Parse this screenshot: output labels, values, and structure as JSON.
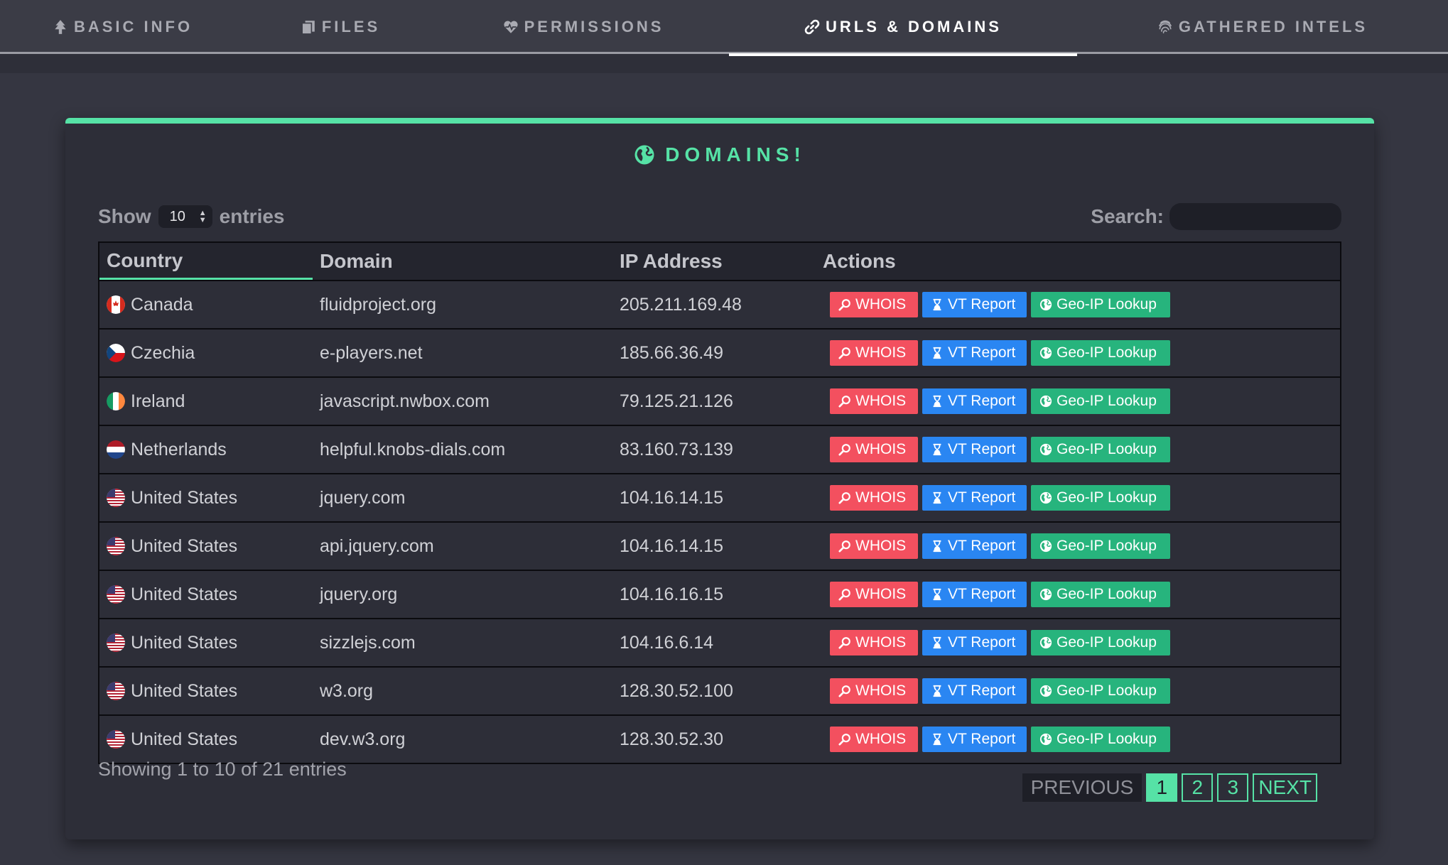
{
  "tabs": [
    {
      "label": "BASIC INFO",
      "icon": "tree-icon",
      "active": false
    },
    {
      "label": "FILES",
      "icon": "files-icon",
      "active": false
    },
    {
      "label": "PERMISSIONS",
      "icon": "heart-pulse-icon",
      "active": false
    },
    {
      "label": "URLS & DOMAINS",
      "icon": "link-icon",
      "active": true
    },
    {
      "label": "GATHERED INTELS",
      "icon": "fingerprint-icon",
      "active": false
    }
  ],
  "card": {
    "title": "DOMAINS!",
    "icon": "globe-icon",
    "accent": "#56e2a6"
  },
  "length": {
    "show_label": "Show",
    "value": "10",
    "entries_label": "entries"
  },
  "search": {
    "label": "Search:",
    "value": ""
  },
  "table": {
    "headers": [
      "Country",
      "Domain",
      "IP Address",
      "Actions"
    ],
    "rows": [
      {
        "country": "Canada",
        "flag": "ca",
        "domain": "fluidproject.org",
        "ip": "205.211.169.48"
      },
      {
        "country": "Czechia",
        "flag": "cz",
        "domain": "e-players.net",
        "ip": "185.66.36.49"
      },
      {
        "country": "Ireland",
        "flag": "ie",
        "domain": "javascript.nwbox.com",
        "ip": "79.125.21.126"
      },
      {
        "country": "Netherlands",
        "flag": "nl",
        "domain": "helpful.knobs-dials.com",
        "ip": "83.160.73.139"
      },
      {
        "country": "United States",
        "flag": "us",
        "domain": "jquery.com",
        "ip": "104.16.14.15"
      },
      {
        "country": "United States",
        "flag": "us",
        "domain": "api.jquery.com",
        "ip": "104.16.14.15"
      },
      {
        "country": "United States",
        "flag": "us",
        "domain": "jquery.org",
        "ip": "104.16.16.15"
      },
      {
        "country": "United States",
        "flag": "us",
        "domain": "sizzlejs.com",
        "ip": "104.16.6.14"
      },
      {
        "country": "United States",
        "flag": "us",
        "domain": "w3.org",
        "ip": "128.30.52.100"
      },
      {
        "country": "United States",
        "flag": "us",
        "domain": "dev.w3.org",
        "ip": "128.30.52.30"
      }
    ],
    "actions": {
      "whois": "WHOIS",
      "vt": "VT Report",
      "geo": "Geo-IP Lookup"
    },
    "action_colors": {
      "whois": "#f3505f",
      "vt": "#2a86f2",
      "geo": "#27b47d"
    }
  },
  "footer": {
    "info": "Showing 1 to 10 of 21 entries",
    "previous": "PREVIOUS",
    "pages": [
      "1",
      "2",
      "3"
    ],
    "current_page": "1",
    "next": "NEXT"
  }
}
